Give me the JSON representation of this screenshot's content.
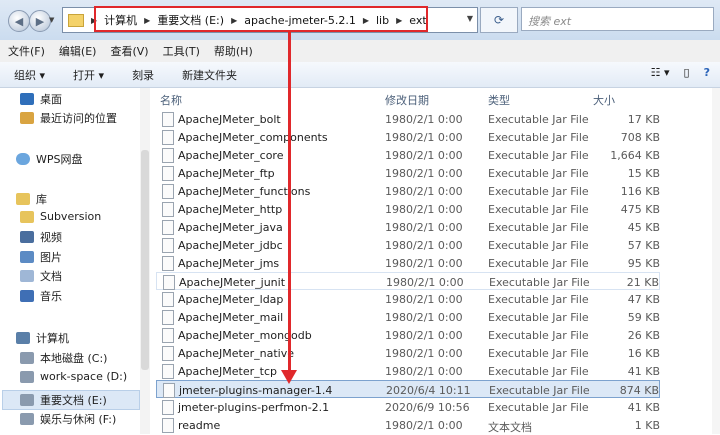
{
  "address": {
    "crumbs": [
      "计算机",
      "重要文档 (E:)",
      "apache-jmeter-5.2.1",
      "lib",
      "ext"
    ]
  },
  "search": {
    "placeholder": "搜索 ext"
  },
  "menu": [
    "文件(F)",
    "编辑(E)",
    "查看(V)",
    "工具(T)",
    "帮助(H)"
  ],
  "toolbar": {
    "organize": "组织 ▾",
    "open": "打开 ▾",
    "burn": "刻录",
    "new_folder": "新建文件夹"
  },
  "sidebar": {
    "desktop": "桌面",
    "recent": "最近访问的位置",
    "wps": "WPS网盘",
    "library": "库",
    "subversion": "Subversion",
    "video": "视频",
    "pictures": "图片",
    "docs": "文档",
    "music": "音乐",
    "computer": "计算机",
    "drive_c": "本地磁盘 (C:)",
    "drive_d": "work-space (D:)",
    "drive_e": "重要文档 (E:)",
    "drive_f": "娱乐与休闲 (F:)"
  },
  "columns": {
    "name": "名称",
    "date": "修改日期",
    "type": "类型",
    "size": "大小"
  },
  "files": [
    {
      "name": "ApacheJMeter_bolt",
      "date": "1980/2/1 0:00",
      "type": "Executable Jar File",
      "size": "17 KB"
    },
    {
      "name": "ApacheJMeter_components",
      "date": "1980/2/1 0:00",
      "type": "Executable Jar File",
      "size": "708 KB"
    },
    {
      "name": "ApacheJMeter_core",
      "date": "1980/2/1 0:00",
      "type": "Executable Jar File",
      "size": "1,664 KB"
    },
    {
      "name": "ApacheJMeter_ftp",
      "date": "1980/2/1 0:00",
      "type": "Executable Jar File",
      "size": "15 KB"
    },
    {
      "name": "ApacheJMeter_functions",
      "date": "1980/2/1 0:00",
      "type": "Executable Jar File",
      "size": "116 KB"
    },
    {
      "name": "ApacheJMeter_http",
      "date": "1980/2/1 0:00",
      "type": "Executable Jar File",
      "size": "475 KB"
    },
    {
      "name": "ApacheJMeter_java",
      "date": "1980/2/1 0:00",
      "type": "Executable Jar File",
      "size": "45 KB"
    },
    {
      "name": "ApacheJMeter_jdbc",
      "date": "1980/2/1 0:00",
      "type": "Executable Jar File",
      "size": "57 KB"
    },
    {
      "name": "ApacheJMeter_jms",
      "date": "1980/2/1 0:00",
      "type": "Executable Jar File",
      "size": "95 KB"
    },
    {
      "name": "ApacheJMeter_junit",
      "date": "1980/2/1 0:00",
      "type": "Executable Jar File",
      "size": "21 KB"
    },
    {
      "name": "ApacheJMeter_ldap",
      "date": "1980/2/1 0:00",
      "type": "Executable Jar File",
      "size": "47 KB"
    },
    {
      "name": "ApacheJMeter_mail",
      "date": "1980/2/1 0:00",
      "type": "Executable Jar File",
      "size": "59 KB"
    },
    {
      "name": "ApacheJMeter_mongodb",
      "date": "1980/2/1 0:00",
      "type": "Executable Jar File",
      "size": "26 KB"
    },
    {
      "name": "ApacheJMeter_native",
      "date": "1980/2/1 0:00",
      "type": "Executable Jar File",
      "size": "16 KB"
    },
    {
      "name": "ApacheJMeter_tcp",
      "date": "1980/2/1 0:00",
      "type": "Executable Jar File",
      "size": "41 KB"
    },
    {
      "name": "jmeter-plugins-manager-1.4",
      "date": "2020/6/4 10:11",
      "type": "Executable Jar File",
      "size": "874 KB"
    },
    {
      "name": "jmeter-plugins-perfmon-2.1",
      "date": "2020/6/9 10:56",
      "type": "Executable Jar File",
      "size": "41 KB"
    },
    {
      "name": "readme",
      "date": "1980/2/1 0:00",
      "type": "文本文档",
      "size": "1 KB"
    }
  ],
  "colors": {
    "highlight": "#e0282b",
    "selection": "#dce8f6",
    "folder": "#f4d26a"
  }
}
